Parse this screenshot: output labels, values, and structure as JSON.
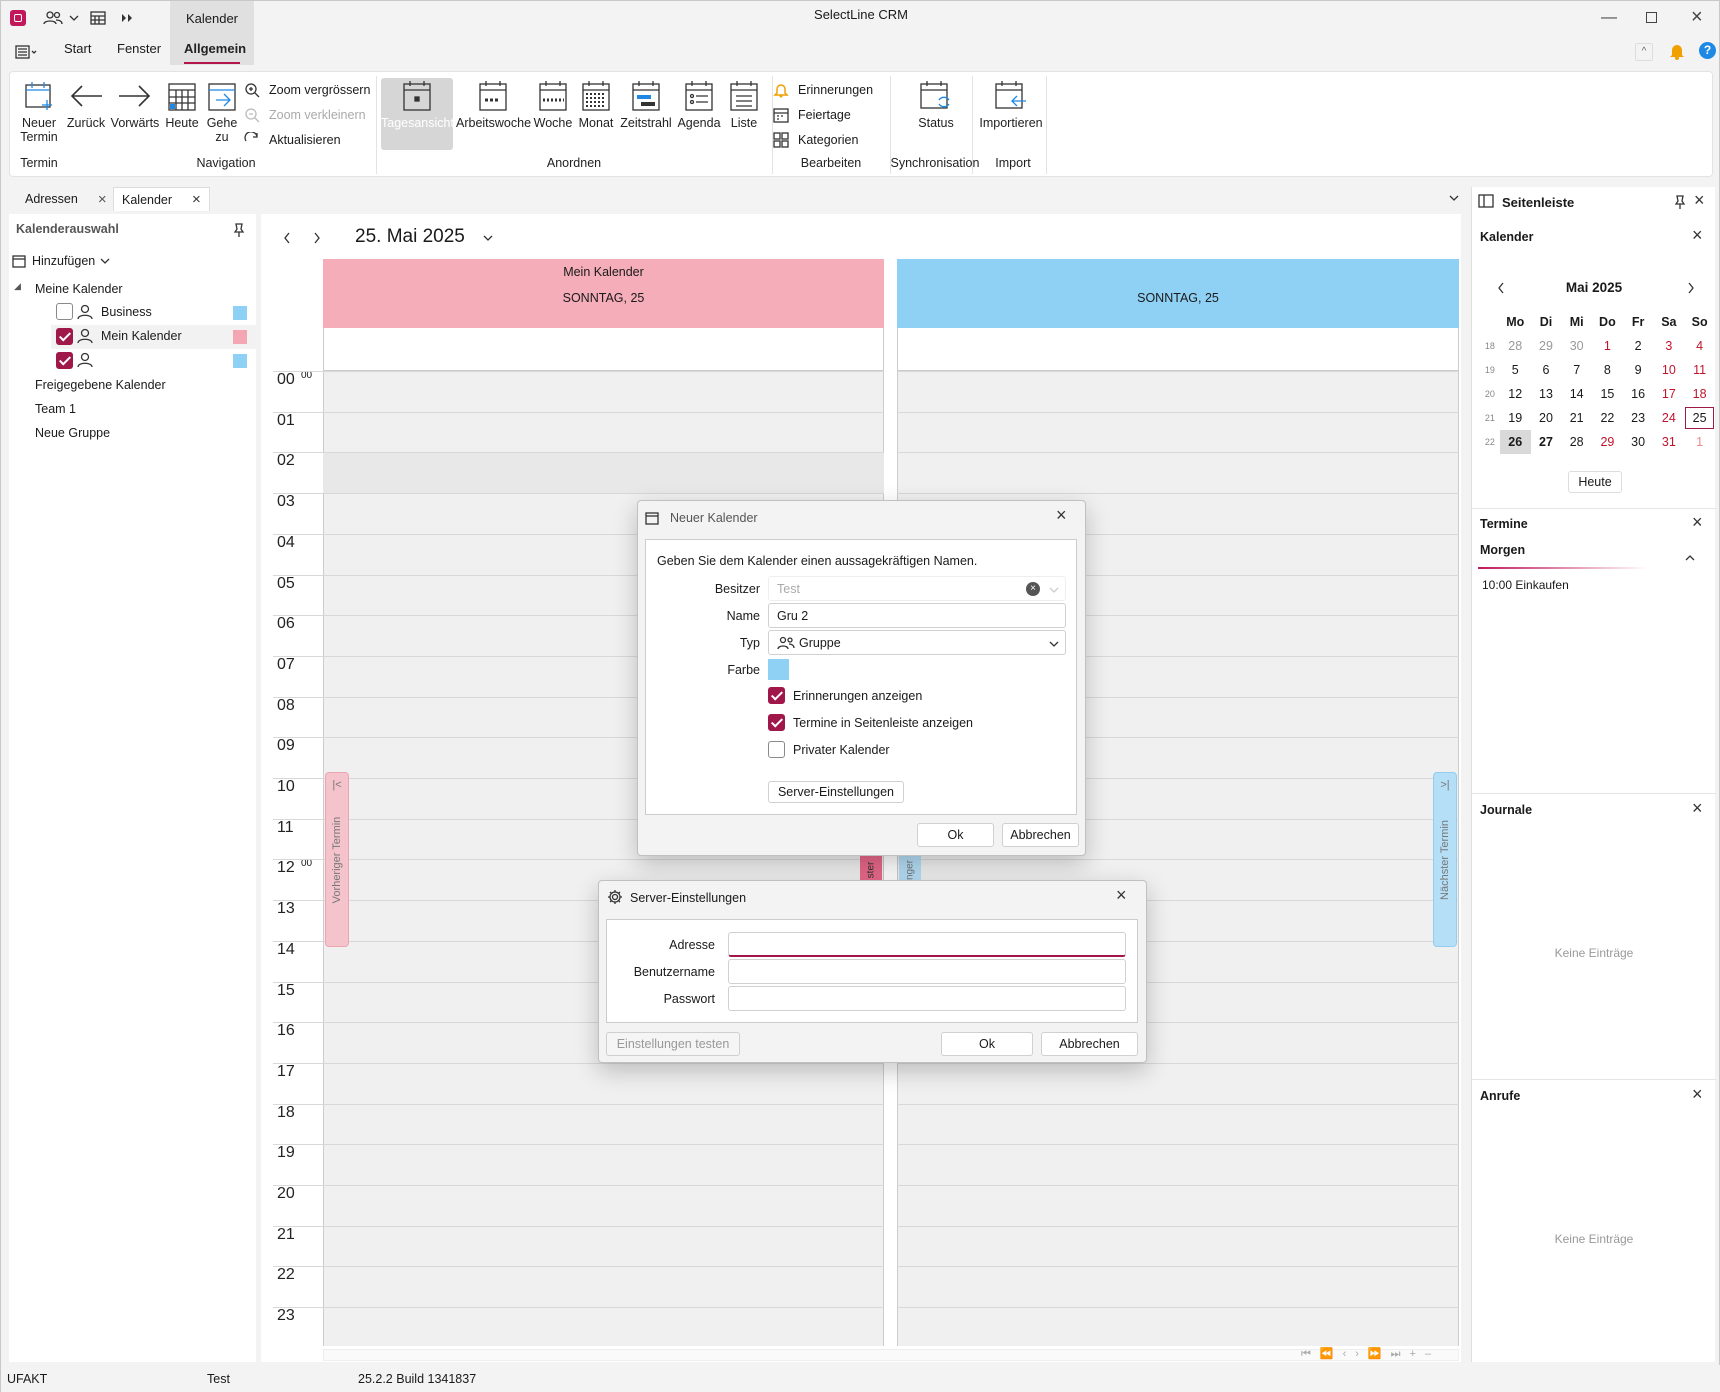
{
  "app_title": "SelectLine CRM",
  "contextual_tab": "Kalender",
  "menu": {
    "start": "Start",
    "fenster": "Fenster",
    "allgemein": "Allgemein"
  },
  "ribbon": {
    "neuer_termin": [
      "Neuer",
      "Termin"
    ],
    "zurueck": "Zurück",
    "vorwaerts": "Vorwärts",
    "heute": "Heute",
    "gehe_zu": [
      "Gehe",
      "zu"
    ],
    "zoom_in": "Zoom vergrössern",
    "zoom_out": "Zoom verkleinern",
    "aktualisieren": "Aktualisieren",
    "tagesansicht": "Tagesansicht",
    "arbeitswoche": "Arbeitswoche",
    "woche": "Woche",
    "monat": "Monat",
    "zeitstrahl": "Zeitstrahl",
    "agenda": "Agenda",
    "liste": "Liste",
    "erinnerungen": "Erinnerungen",
    "feiertage": "Feiertage",
    "kategorien": "Kategorien",
    "status": "Status",
    "importieren": "Importieren",
    "groups": {
      "termin": "Termin",
      "navigation": "Navigation",
      "anordnen": "Anordnen",
      "bearbeiten": "Bearbeiten",
      "sync": "Synchronisation",
      "import": "Import"
    }
  },
  "doc_tabs": [
    "Adressen",
    "Kalender"
  ],
  "left_pane": {
    "title": "Kalenderauswahl",
    "add": "Hinzufügen",
    "meine": "Meine Kalender",
    "items": [
      {
        "label": "Business",
        "checked": false,
        "color": "#8fd0f5"
      },
      {
        "label": "Mein Kalender",
        "checked": true,
        "color": "#f4a6b5"
      },
      {
        "label": "",
        "checked": true,
        "color": "#8fd0f5"
      }
    ],
    "freigegebene": "Freigegebene Kalender",
    "team": "Team 1",
    "neue_gruppe": "Neue Gruppe"
  },
  "calendar": {
    "date_title": "25. Mai 2025",
    "col1_name": "Mein Kalender",
    "col1_day": "SONNTAG, 25",
    "col2_day": "SONNTAG, 25",
    "hours": [
      "00",
      "01",
      "02",
      "03",
      "04",
      "05",
      "06",
      "07",
      "08",
      "09",
      "10",
      "11",
      "12",
      "13",
      "14",
      "15",
      "16",
      "17",
      "18",
      "19",
      "20",
      "21",
      "22",
      "23"
    ],
    "minute_mark": "00",
    "prev_label": "Vorheriger Termin",
    "next_label": "Nächster Termin",
    "mini_left": "ster",
    "mini_right": "nger"
  },
  "sidebar": {
    "title": "Seitenleiste",
    "kalender": "Kalender",
    "month": "Mai 2025",
    "weekdays": [
      "Mo",
      "Di",
      "Mi",
      "Do",
      "Fr",
      "Sa",
      "So"
    ],
    "weeks": [
      {
        "wk": "18",
        "days": [
          "28",
          "29",
          "30",
          "1",
          "2",
          "3",
          "4"
        ]
      },
      {
        "wk": "19",
        "days": [
          "5",
          "6",
          "7",
          "8",
          "9",
          "10",
          "11"
        ]
      },
      {
        "wk": "20",
        "days": [
          "12",
          "13",
          "14",
          "15",
          "16",
          "17",
          "18"
        ]
      },
      {
        "wk": "21",
        "days": [
          "19",
          "20",
          "21",
          "22",
          "23",
          "24",
          "25"
        ]
      },
      {
        "wk": "22",
        "days": [
          "26",
          "27",
          "28",
          "29",
          "30",
          "31",
          "1"
        ]
      }
    ],
    "heute": "Heute",
    "termine": "Termine",
    "morgen": "Morgen",
    "termin_entry": "10:00  Einkaufen",
    "journale": "Journale",
    "keine1": "Keine Einträge",
    "anrufe": "Anrufe",
    "keine2": "Keine Einträge"
  },
  "dialog_kalender": {
    "title": "Neuer Kalender",
    "intro": "Geben Sie dem Kalender einen aussagekräftigen Namen.",
    "besitzer_label": "Besitzer",
    "besitzer_value": "Test",
    "name_label": "Name",
    "name_value": "Gru 2",
    "typ_label": "Typ",
    "typ_value": "Gruppe",
    "farbe_label": "Farbe",
    "farbe_color": "#8fd0f5",
    "chk_erinnerungen": "Erinnerungen anzeigen",
    "chk_termine": "Termine in Seitenleiste anzeigen",
    "chk_privat": "Privater Kalender",
    "server_btn": "Server-Einstellungen",
    "ok": "Ok",
    "abbrechen": "Abbrechen"
  },
  "dialog_server": {
    "title": "Server-Einstellungen",
    "adresse": "Adresse",
    "benutzername": "Benutzername",
    "passwort": "Passwort",
    "testen": "Einstellungen testen",
    "ok": "Ok",
    "abbrechen": "Abbrechen"
  },
  "statusbar": {
    "db": "UFAKT",
    "user": "Test",
    "version": "25.2.2 Build 1341837"
  },
  "colors": {
    "accent": "#a0174a",
    "pink": "#f4adb9",
    "blue": "#8fd0f5"
  }
}
